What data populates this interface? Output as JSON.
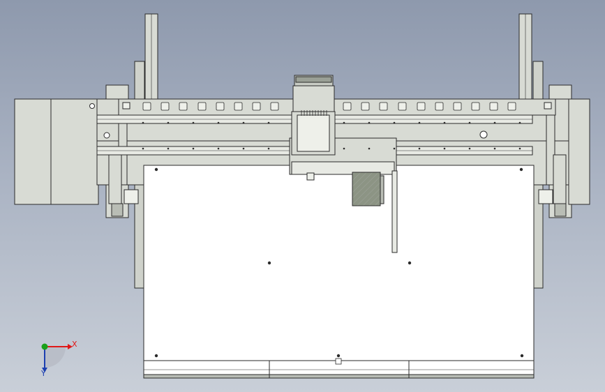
{
  "viewport": {
    "background_top": "#8e99ad",
    "background_bottom": "#c9cfd8"
  },
  "model": {
    "part_color": "#d8dbd4",
    "table_color": "#ffffff",
    "edge_color": "#2a2a2a",
    "motor_color": "#8c9484",
    "hatch_color": "#c2c6bf"
  },
  "triad": {
    "x_label": "X",
    "y_label": "Y",
    "x_color": "#e01818",
    "y_color": "#1c3fb0",
    "z_color": "#1aa01a",
    "icons": [
      "axis-triad-icon"
    ]
  }
}
